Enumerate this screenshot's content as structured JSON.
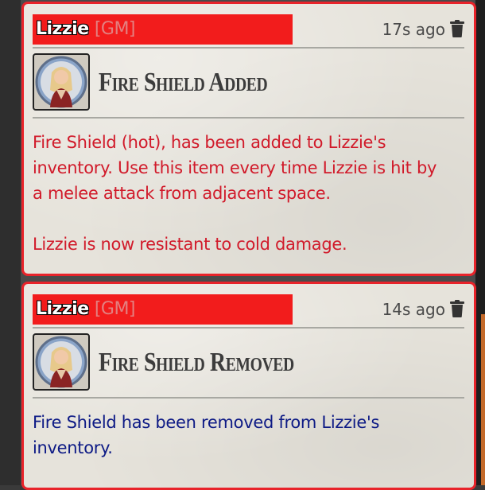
{
  "messages": [
    {
      "sender": "Lizzie",
      "role": "[GM]",
      "time": "17s ago",
      "title": "Fire Shield Added",
      "body": [
        "Fire Shield (hot), has been added to Lizzie's",
        "inventory. Use this item every time Lizzie is hit by",
        "a melee attack from adjacent space.",
        "",
        "Lizzie is now resistant to cold damage."
      ],
      "body_color": "#d11a2a"
    },
    {
      "sender": "Lizzie",
      "role": "[GM]",
      "time": "14s ago",
      "title": "Fire Shield Removed",
      "body": [
        "Fire Shield has been removed from Lizzie's",
        "inventory."
      ],
      "body_color": "#0d1a85"
    }
  ],
  "icons": {
    "delete": "trash-icon",
    "avatar": "character-portrait"
  },
  "colors": {
    "border": "#e8232a",
    "name_bar": "#f21c1c"
  }
}
